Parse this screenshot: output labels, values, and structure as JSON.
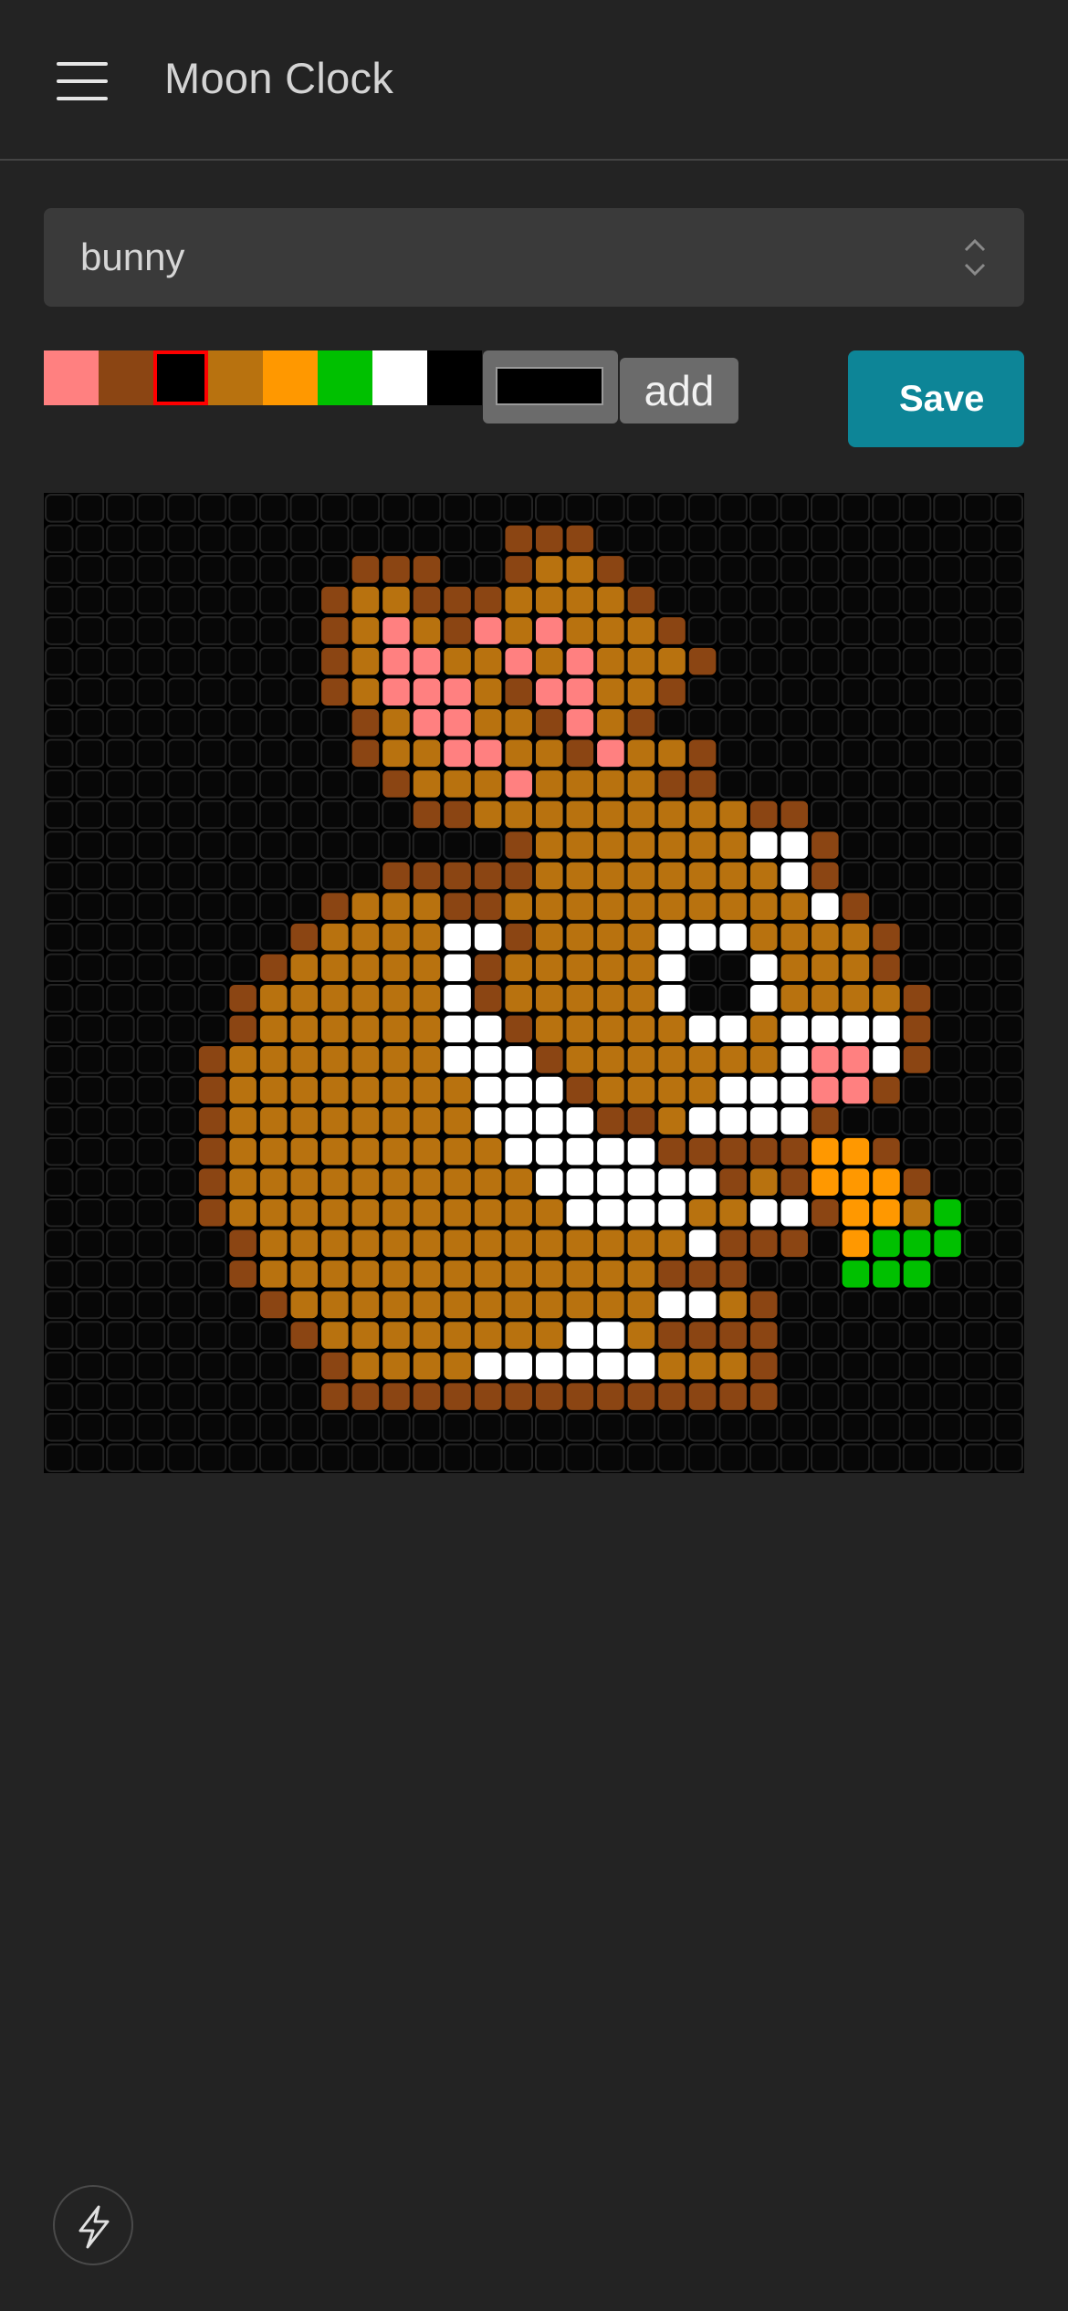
{
  "header": {
    "menu_icon": "hamburger-menu-icon",
    "title": "Moon Clock"
  },
  "image_select": {
    "value": "bunny",
    "icon": "chevron-up-down-icon"
  },
  "palette": {
    "colors": [
      "#ff8080",
      "#8b4513",
      "#000000",
      "#b8720f",
      "#ff9800",
      "#00c000",
      "#ffffff",
      "#000000"
    ],
    "selected_index": 2,
    "picker_value": "#000000"
  },
  "add_label": "add",
  "save_label": "Save",
  "pixel_art": {
    "size": 32,
    "colors": {
      "D": "#8b4513",
      "M": "#b8720f",
      "P": "#ff8080",
      "W": "#ffffff",
      "O": "#ff9800",
      "G": "#00c000"
    },
    "rows": [
      "................................",
      "...............DDD..............",
      "..........DDD..DMMD.............",
      ".........DMMDDDMMMMD............",
      ".........DMPMDPMPMMMD...........",
      ".........DMPPMMPMPMMMD..........",
      ".........DMPPPMDPPMMD...........",
      "..........DMPPMMDPMD............",
      "..........DMMPPMMDPMMD..........",
      "...........DMMMPMMMMDD..........",
      "............DDMMMMMMMMMDD.......",
      "...............DMMMMMMMWWD......",
      "...........DDDDDMMMMMMMMWD......",
      ".........DMMMDDMMMMMMMMMMWD.....",
      "........DMMMMWWDMMMMWWWMMMMD....",
      ".......DMMMMMWDMMMMMW..WMMMD....",
      "......DMMMMMMWDMMMMMW..WMMMMD...",
      "......DMMMMMMWWDMMMMMWWMWWWWD...",
      ".....DMMMMMMMWWWDMMMMMMMWPPWD...",
      ".....DMMMMMMMMWWWDMMMMWWWPPD....",
      ".....DMMMMMMMMWWWWDDMWWWWD......",
      ".....DMMMMMMMMMWWWWWDDDDDOOD....",
      ".....DMMMMMMMMMMWWWWWWDMDOOOD...",
      ".....DMMMMMMMMMMMWWWWMMWWDOOMG..",
      "......DMMMMMMMMMMMMMMWDDD.OGGG..",
      "......DMMMMMMMMMMMMMDDD...GGG...",
      ".......DMMMMMMMMMMMMWWMD........",
      "........DMMMMMMMMWWMDDDD........",
      ".........DMMMMWWWWWWMMMD........",
      ".........DDDDDDDDDDDDDDD........",
      "................................",
      "................................"
    ]
  },
  "fab_icon": "lightning-bolt-icon"
}
